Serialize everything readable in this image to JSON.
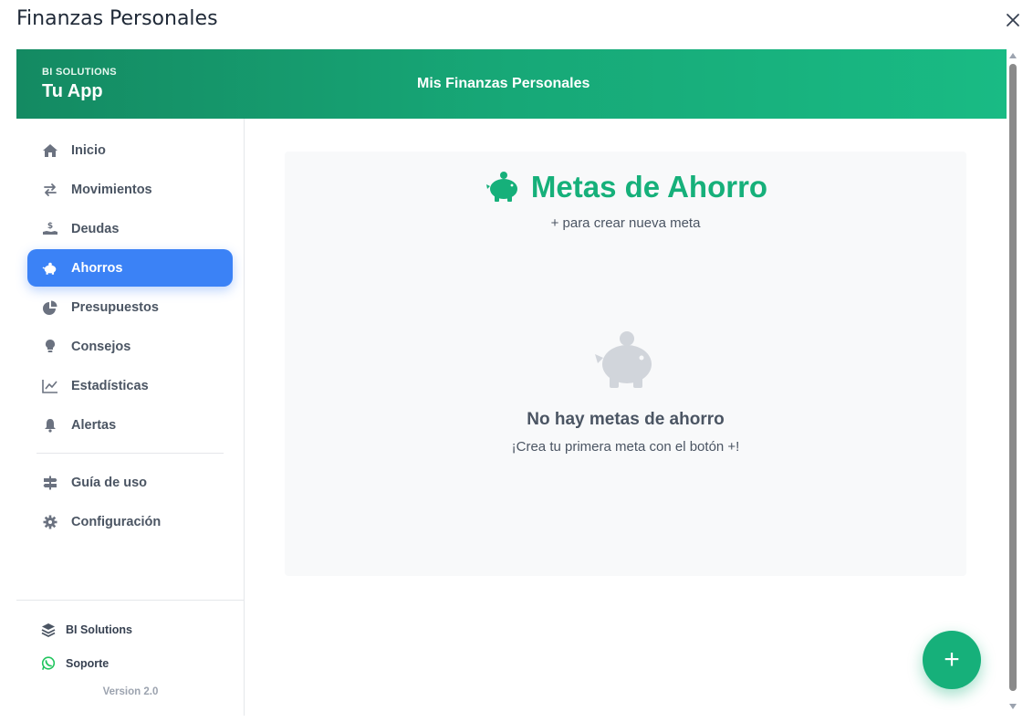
{
  "window": {
    "title": "Finanzas Personales"
  },
  "header": {
    "brand_small": "BI SOLUTIONS",
    "brand_name": "Tu App",
    "title": "Mis Finanzas Personales"
  },
  "sidebar": {
    "items": [
      {
        "label": "Inicio",
        "icon": "home-icon"
      },
      {
        "label": "Movimientos",
        "icon": "exchange-icon"
      },
      {
        "label": "Deudas",
        "icon": "hand-dollar-icon"
      },
      {
        "label": "Ahorros",
        "icon": "piggy-bank-icon",
        "active": true
      },
      {
        "label": "Presupuestos",
        "icon": "pie-chart-icon"
      },
      {
        "label": "Consejos",
        "icon": "lightbulb-icon"
      },
      {
        "label": "Estadísticas",
        "icon": "line-chart-icon"
      },
      {
        "label": "Alertas",
        "icon": "bell-icon"
      }
    ],
    "secondary_items": [
      {
        "label": "Guía de uso",
        "icon": "signpost-icon"
      },
      {
        "label": "Configuración",
        "icon": "gear-icon"
      }
    ],
    "footer": {
      "company": "BI Solutions",
      "support": "Soporte",
      "version": "Version 2.0"
    }
  },
  "main": {
    "title": "Metas de Ahorro",
    "subtitle": "+ para crear nueva meta",
    "empty_title": "No hay metas de ahorro",
    "empty_subtitle": "¡Crea tu primera meta con el botón +!"
  },
  "fab": {
    "label": "+"
  },
  "colors": {
    "accent": "#16b07a",
    "active_nav": "#3b82f6",
    "header_start": "#148a62",
    "header_end": "#19bb84",
    "whatsapp": "#22c55e"
  }
}
